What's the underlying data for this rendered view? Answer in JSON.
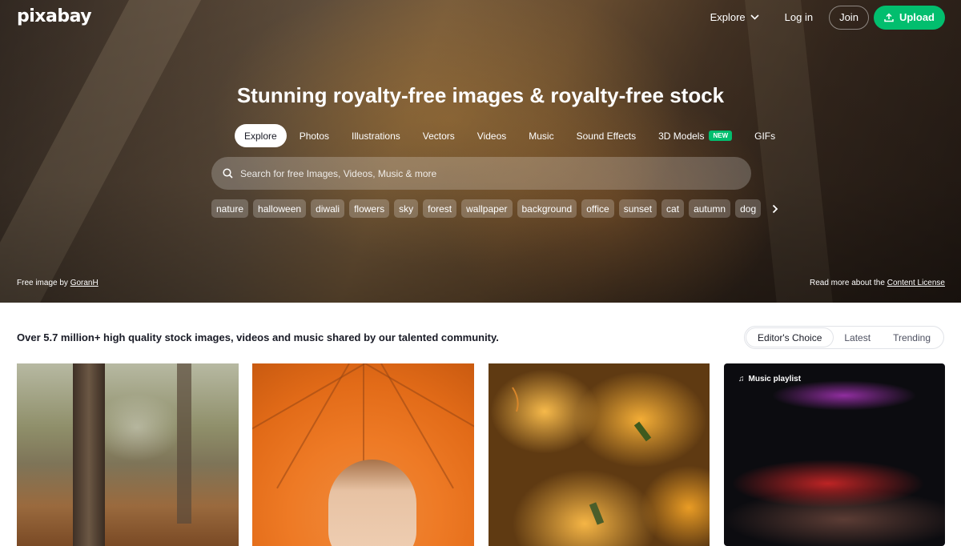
{
  "brand": {
    "logo_text": "pixabay"
  },
  "topnav": {
    "explore_label": "Explore",
    "login_label": "Log in",
    "join_label": "Join",
    "upload_label": "Upload"
  },
  "hero": {
    "headline": "Stunning royalty-free images & royalty-free stock",
    "tabs": [
      {
        "label": "Explore",
        "active": true
      },
      {
        "label": "Photos"
      },
      {
        "label": "Illustrations"
      },
      {
        "label": "Vectors"
      },
      {
        "label": "Videos"
      },
      {
        "label": "Music"
      },
      {
        "label": "Sound Effects"
      },
      {
        "label": "3D Models",
        "badge": "NEW"
      },
      {
        "label": "GIFs"
      }
    ],
    "search": {
      "placeholder": "Search for free Images, Videos, Music & more"
    },
    "chips": [
      "nature",
      "halloween",
      "diwali",
      "flowers",
      "sky",
      "forest",
      "wallpaper",
      "background",
      "office",
      "sunset",
      "cat",
      "autumn",
      "dog"
    ],
    "credit": {
      "prefix": "Free image by ",
      "author": "GoranH"
    },
    "license": {
      "prefix": "Read more about the ",
      "link": "Content License"
    }
  },
  "main": {
    "tagline": "Over 5.7 million+ high quality stock images, videos and music shared by our talented community.",
    "sort_options": [
      {
        "label": "Editor's Choice",
        "active": true
      },
      {
        "label": "Latest"
      },
      {
        "label": "Trending"
      }
    ],
    "cards": [
      {
        "kind": "image",
        "icon": "squirrel-photo"
      },
      {
        "kind": "image",
        "icon": "umbrella-portrait-photo"
      },
      {
        "kind": "image",
        "icon": "pumpkins-photo"
      },
      {
        "kind": "music",
        "label": "Music playlist",
        "icon": "music-note-icon"
      }
    ]
  },
  "colors": {
    "accent": "#02be6e",
    "text": "#191b26"
  }
}
